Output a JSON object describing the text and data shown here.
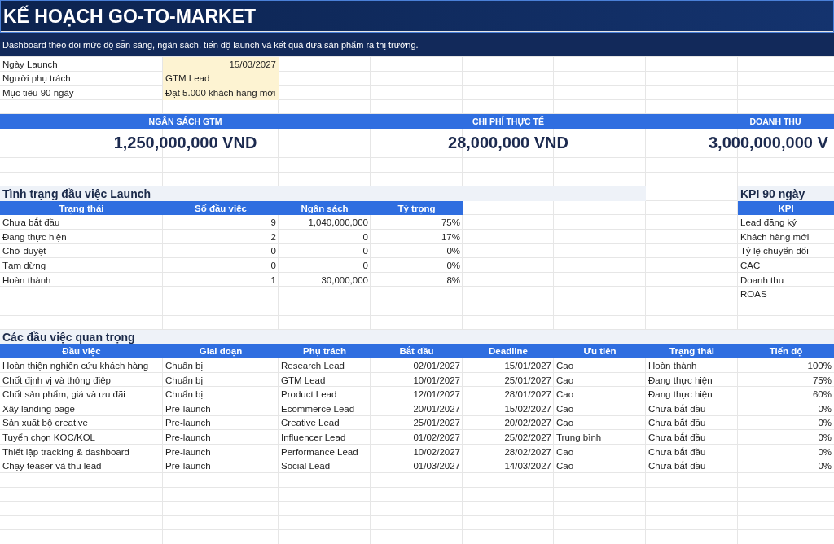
{
  "title": "KẾ HOẠCH GO-TO-MARKET",
  "description": "Dashboard theo dõi mức độ sẵn sàng, ngân sách, tiến độ launch và kết quả đưa sản phẩm ra thị trường.",
  "info": [
    {
      "label": "Ngày Launch",
      "value": "15/03/2027"
    },
    {
      "label": "Người phụ trách",
      "value": "GTM Lead"
    },
    {
      "label": "Mục tiêu 90 ngày",
      "value": "Đạt 5.000 khách hàng mới"
    }
  ],
  "metrics": [
    {
      "label": "NGÂN SÁCH GTM",
      "value": "1,250,000,000 VND"
    },
    {
      "label": "CHI PHÍ THỰC TẾ",
      "value": "28,000,000 VND"
    },
    {
      "label": "DOANH THU",
      "value": "3,000,000,000 V"
    }
  ],
  "status_table": {
    "title": "Tình trạng đầu việc Launch",
    "columns": [
      "Trạng thái",
      "Số đầu việc",
      "Ngân sách",
      "Tỷ trọng"
    ],
    "rows": [
      [
        "Chưa bắt đầu",
        "9",
        "1,040,000,000",
        "75%"
      ],
      [
        "Đang thực hiện",
        "2",
        "0",
        "17%"
      ],
      [
        "Chờ duyệt",
        "0",
        "0",
        "0%"
      ],
      [
        "Tạm dừng",
        "0",
        "0",
        "0%"
      ],
      [
        "Hoàn thành",
        "1",
        "30,000,000",
        "8%"
      ]
    ]
  },
  "kpi_table": {
    "title": "KPI 90 ngày",
    "columns": [
      "KPI"
    ],
    "rows": [
      [
        "Lead đăng ký"
      ],
      [
        "Khách hàng mới"
      ],
      [
        "Tỷ lệ chuyển đổi"
      ],
      [
        "CAC"
      ],
      [
        "Doanh thu"
      ],
      [
        "ROAS"
      ]
    ]
  },
  "tasks_table": {
    "title": "Các đầu việc quan trọng",
    "columns": [
      "Đầu việc",
      "Giai đoạn",
      "Phụ trách",
      "Bắt đầu",
      "Deadline",
      "Ưu tiên",
      "Trạng thái",
      "Tiến độ"
    ],
    "rows": [
      [
        "Hoàn thiện nghiên cứu khách hàng",
        "Chuẩn bị",
        "Research Lead",
        "02/01/2027",
        "15/01/2027",
        "Cao",
        "Hoàn thành",
        "100%"
      ],
      [
        "Chốt định vị và thông điệp",
        "Chuẩn bị",
        "GTM Lead",
        "10/01/2027",
        "25/01/2027",
        "Cao",
        "Đang thực hiện",
        "75%"
      ],
      [
        "Chốt sản phẩm, giá và ưu đãi",
        "Chuẩn bị",
        "Product Lead",
        "12/01/2027",
        "28/01/2027",
        "Cao",
        "Đang thực hiện",
        "60%"
      ],
      [
        "Xây landing page",
        "Pre-launch",
        "Ecommerce Lead",
        "20/01/2027",
        "15/02/2027",
        "Cao",
        "Chưa bắt đầu",
        "0%"
      ],
      [
        "Sản xuất bộ creative",
        "Pre-launch",
        "Creative Lead",
        "25/01/2027",
        "20/02/2027",
        "Cao",
        "Chưa bắt đầu",
        "0%"
      ],
      [
        "Tuyển chọn KOC/KOL",
        "Pre-launch",
        "Influencer Lead",
        "01/02/2027",
        "25/02/2027",
        "Trung bình",
        "Chưa bắt đầu",
        "0%"
      ],
      [
        "Thiết lập tracking & dashboard",
        "Pre-launch",
        "Performance Lead",
        "10/02/2027",
        "28/02/2027",
        "Cao",
        "Chưa bắt đầu",
        "0%"
      ],
      [
        "Chạy teaser và thu lead",
        "Pre-launch",
        "Social Lead",
        "01/03/2027",
        "14/03/2027",
        "Cao",
        "Chưa bắt đầu",
        "0%"
      ]
    ]
  }
}
